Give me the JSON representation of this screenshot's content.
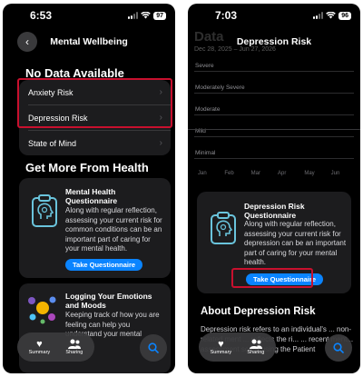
{
  "left": {
    "status": {
      "time": "6:53",
      "battery": "97"
    },
    "nav": {
      "title": "Mental Wellbeing"
    },
    "no_data": {
      "title": "No Data Available",
      "items": [
        {
          "label": "Anxiety Risk"
        },
        {
          "label": "Depression Risk"
        },
        {
          "label": "State of Mind"
        }
      ]
    },
    "get_more": {
      "title": "Get More From Health"
    },
    "questionnaire_card": {
      "title": "Mental Health Questionnaire",
      "text": "Along with regular reflection, assessing your current risk for common conditions can be an important part of caring for your mental health.",
      "button": "Take Questionnaire"
    },
    "logging_card": {
      "title": "Logging Your Emotions and Moods",
      "text": "Keeping track of how you are feeling can help you understand your mental"
    },
    "tabbar": {
      "summary": "Summary",
      "sharing": "Sharing"
    }
  },
  "right": {
    "status": {
      "time": "7:03",
      "battery": "96"
    },
    "nav": {
      "title": "Depression Risk"
    },
    "chart_data": {
      "type": "area",
      "title": "Data",
      "subtitle": "Dec 28, 2025 – Jun 27, 2026",
      "categories": [
        "Jan",
        "Feb",
        "Mar",
        "Apr",
        "May",
        "Jun"
      ],
      "y_levels": [
        "Severe",
        "Moderately Severe",
        "Moderate",
        "Mild",
        "Minimal"
      ],
      "series": [],
      "grid": true
    },
    "questionnaire_card": {
      "title": "Depression Risk Questionnaire",
      "text": "Along with regular reflection, assessing your current risk for depression can be an important part of caring for your mental health.",
      "button": "Take Questionnaire"
    },
    "about": {
      "title": "About Depression Risk",
      "text": "Depression risk refers to an individual's ... non-related ment ... reflects the ri... ... recent ment... assessment score using the Patient"
    },
    "tabbar": {
      "summary": "Summary",
      "sharing": "Sharing"
    }
  },
  "colors": {
    "accent": "#0a84ff",
    "highlight": "#c8102e",
    "background": "#000000",
    "card": "#1c1c1e"
  }
}
